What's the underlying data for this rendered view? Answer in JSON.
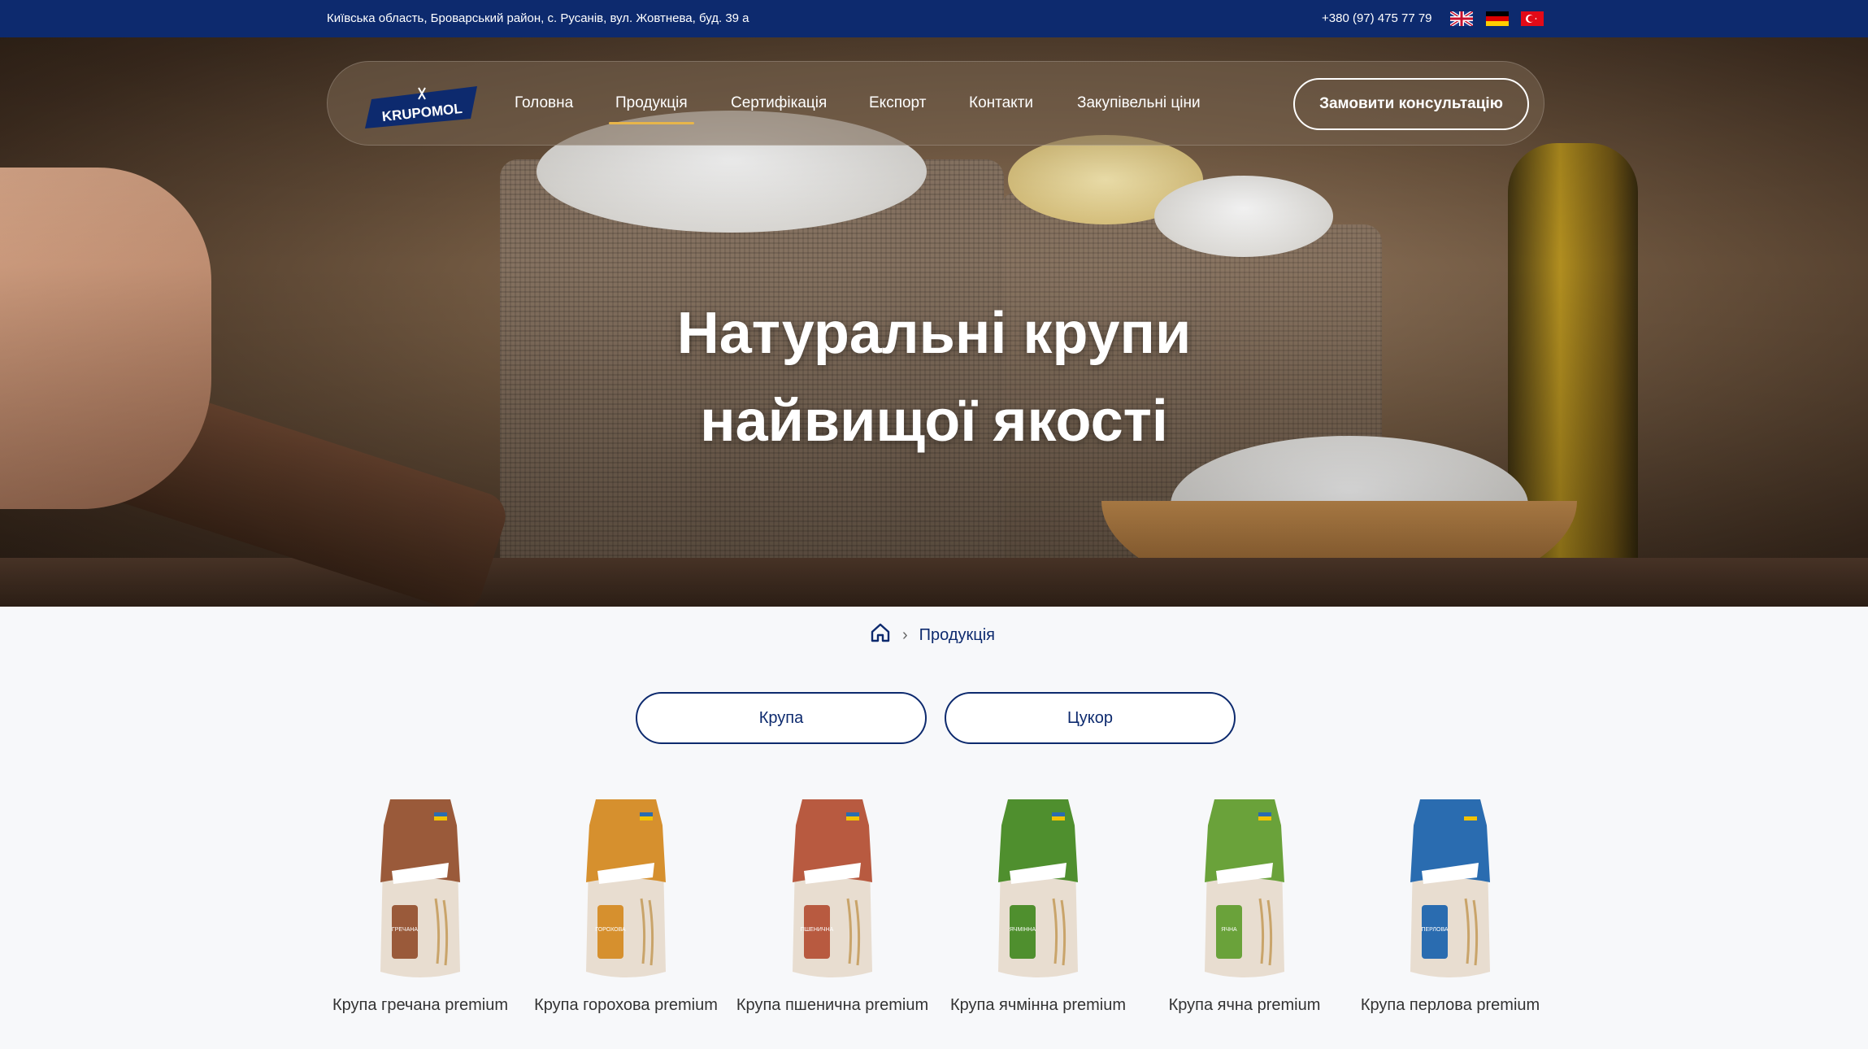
{
  "topbar": {
    "address": "Київська область, Броварський район, с. Русанів, вул. Жовтнева, буд. 39 а",
    "phone": "+380 (97) 475 77 79",
    "languages": [
      "en-flag-icon",
      "de-flag-icon",
      "tr-flag-icon"
    ]
  },
  "brand": {
    "logo_text": "KRUPOMOL",
    "primary_color": "#0d2a6e",
    "accent_color": "#e7b54a"
  },
  "nav": {
    "items": [
      "Головна",
      "Продукція",
      "Сертифікація",
      "Експорт",
      "Контакти",
      "Закупівельні ціни"
    ],
    "active": "Продукція",
    "cta_label": "Замовити консультацію"
  },
  "hero": {
    "line1": "Натуральні крупи",
    "line2": "найвищої якості"
  },
  "breadcrumb": {
    "home_icon": "home-icon",
    "separator": "›",
    "current": "Продукція"
  },
  "categories": [
    "Крупа",
    "Цукор"
  ],
  "products": [
    {
      "name": "Крупа гречана premium",
      "color": "#9a5a3a",
      "bag_label": "ГРЕЧАНА"
    },
    {
      "name": "Крупа горохова premium",
      "color": "#d6902e",
      "bag_label": "ГОРОХОВА"
    },
    {
      "name": "Крупа пшенична premium",
      "color": "#b85a40",
      "bag_label": "ПШЕНИЧНА"
    },
    {
      "name": "Крупа ячмінна premium",
      "color": "#4f8f2e",
      "bag_label": "ЯЧМІННА"
    },
    {
      "name": "Крупа ячна premium",
      "color": "#6aa23a",
      "bag_label": "ЯЧНА"
    },
    {
      "name": "Крупа перлова premium",
      "color": "#2a6cb0",
      "bag_label": "ПЕРЛОВА"
    }
  ]
}
